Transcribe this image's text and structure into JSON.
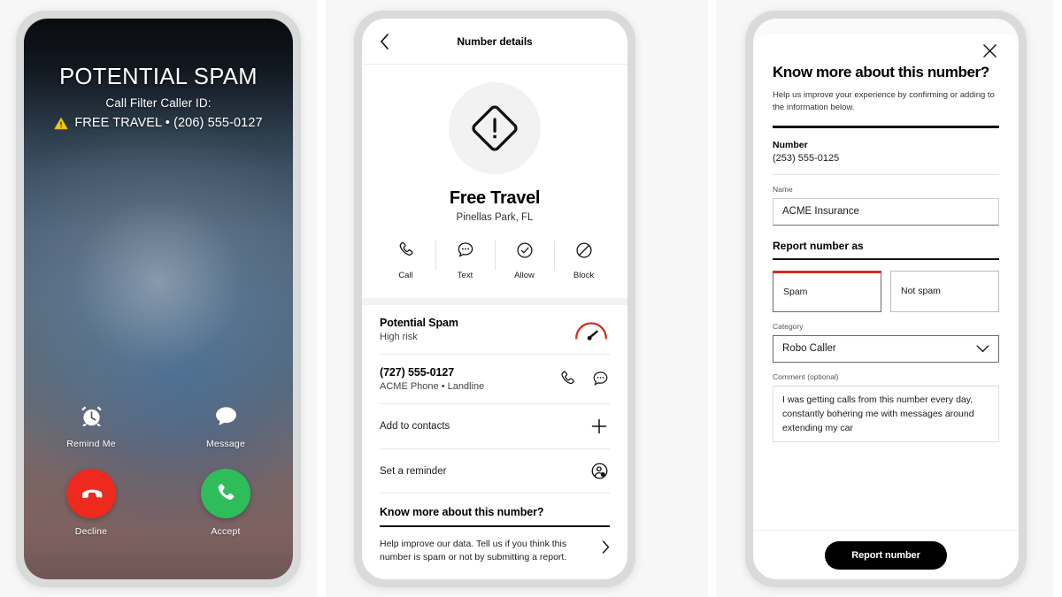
{
  "colors": {
    "accent_red": "#d52b1e",
    "decline_red": "#ec2b1e",
    "accept_green": "#2fbd5b",
    "warning_yellow": "#f2c512",
    "bezel_gray": "#d9dbdb",
    "panel_bg": "#f7f7f7",
    "black": "#000000"
  },
  "phone1": {
    "title": "POTENTIAL SPAM",
    "subtitle": "Call Filter Caller ID:",
    "caller_id": "FREE TRAVEL • (206) 555-0127",
    "warning_icon": "warning-triangle-icon",
    "actions": [
      {
        "label": "Remind Me",
        "icon": "alarm-clock-icon"
      },
      {
        "label": "Message",
        "icon": "speech-bubble-icon"
      }
    ],
    "call_buttons": [
      {
        "label": "Decline",
        "icon": "phone-down-icon",
        "color": "#ec2b1e"
      },
      {
        "label": "Accept",
        "icon": "phone-icon",
        "color": "#2fbd5b"
      }
    ]
  },
  "phone2": {
    "nav": {
      "back_icon": "chevron-left-icon",
      "title": "Number details"
    },
    "hero": {
      "avatar_icon": "warning-diamond-icon",
      "name": "Free Travel",
      "location": "Pinellas Park, FL"
    },
    "quick_actions": [
      {
        "label": "Call",
        "icon": "phone-icon"
      },
      {
        "label": "Text",
        "icon": "chat-bubble-dots-icon"
      },
      {
        "label": "Allow",
        "icon": "check-circle-icon"
      },
      {
        "label": "Block",
        "icon": "block-circle-icon"
      }
    ],
    "risk": {
      "title": "Potential Spam",
      "subtitle": "High risk",
      "icon": "risk-gauge-icon"
    },
    "number_row": {
      "number": "(727) 555-0127",
      "carrier": "ACME Phone • Landline",
      "icons": [
        "phone-icon",
        "chat-bubble-dots-icon"
      ]
    },
    "rows": [
      {
        "label": "Add to contacts",
        "icon": "plus-icon"
      },
      {
        "label": "Set a reminder",
        "icon": "reminder-person-icon"
      }
    ],
    "section_heading": "Know more about this number?",
    "footer_text": "Help improve our data. Tell us if you think this number is spam or not by submitting a report.",
    "footer_icon": "chevron-right-icon"
  },
  "phone3": {
    "close_icon": "close-icon",
    "title": "Know more about this number?",
    "description": "Help us improve your experience by confirming or adding to the information below.",
    "number_label": "Number",
    "number_value": "(253) 555-0125",
    "name_label": "Name",
    "name_value": "ACME Insurance",
    "report_heading": "Report number as",
    "choices": [
      {
        "label": "Spam",
        "selected": true
      },
      {
        "label": "Not spam",
        "selected": false
      }
    ],
    "category_label": "Category",
    "category_value": "Robo Caller",
    "category_icon": "chevron-down-icon",
    "comment_label": "Comment (optional)",
    "comment_value": "I was getting calls from this number every day, constantly bohering me with messages around extending my car",
    "submit_label": "Report number"
  }
}
